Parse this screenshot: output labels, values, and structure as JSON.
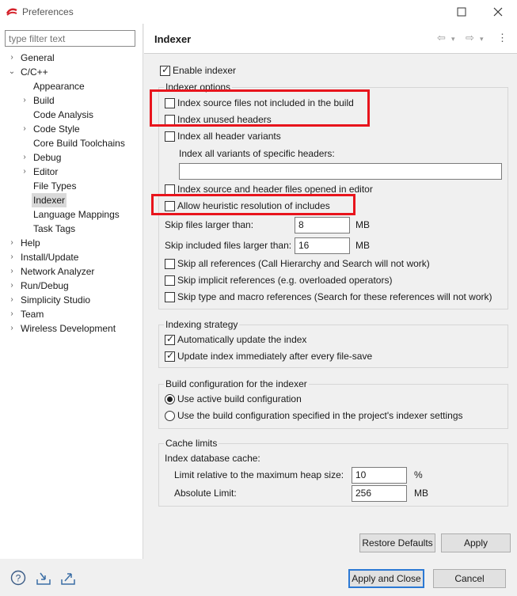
{
  "window": {
    "title": "Preferences"
  },
  "sidebar": {
    "filter_placeholder": "type filter text",
    "items": [
      {
        "label": "General",
        "twisty": "›"
      },
      {
        "label": "C/C++",
        "twisty": "⌄"
      },
      {
        "label": "Appearance",
        "twisty": ""
      },
      {
        "label": "Build",
        "twisty": "›"
      },
      {
        "label": "Code Analysis",
        "twisty": ""
      },
      {
        "label": "Code Style",
        "twisty": "›"
      },
      {
        "label": "Core Build Toolchains",
        "twisty": ""
      },
      {
        "label": "Debug",
        "twisty": "›"
      },
      {
        "label": "Editor",
        "twisty": "›"
      },
      {
        "label": "File Types",
        "twisty": ""
      },
      {
        "label": "Indexer",
        "twisty": ""
      },
      {
        "label": "Language Mappings",
        "twisty": ""
      },
      {
        "label": "Task Tags",
        "twisty": ""
      },
      {
        "label": "Help",
        "twisty": "›"
      },
      {
        "label": "Install/Update",
        "twisty": "›"
      },
      {
        "label": "Network Analyzer",
        "twisty": "›"
      },
      {
        "label": "Run/Debug",
        "twisty": "›"
      },
      {
        "label": "Simplicity Studio",
        "twisty": "›"
      },
      {
        "label": "Team",
        "twisty": "›"
      },
      {
        "label": "Wireless Development",
        "twisty": "›"
      }
    ]
  },
  "page": {
    "title": "Indexer",
    "enable_indexer": {
      "label": "Enable indexer",
      "checked": true
    },
    "indexer_options": {
      "title": "Indexer options",
      "index_source_not_in_build": {
        "label": "Index source files not included in the build",
        "checked": false
      },
      "index_unused_headers": {
        "label": "Index unused headers",
        "checked": false
      },
      "index_all_header_variants": {
        "label": "Index all header variants",
        "checked": false
      },
      "variants_specific_label": "Index all variants of specific headers:",
      "variants_specific_value": "",
      "index_opened_in_editor": {
        "label": "Index source and header files opened in editor",
        "checked": false
      },
      "heuristic_resolution": {
        "label": "Allow heuristic resolution of includes",
        "checked": false
      },
      "skip_files_label": "Skip files larger than:",
      "skip_files_value": "8",
      "skip_files_unit": "MB",
      "skip_included_label": "Skip included files larger than:",
      "skip_included_value": "16",
      "skip_included_unit": "MB",
      "skip_all_refs": {
        "label": "Skip all references (Call Hierarchy and Search will not work)",
        "checked": false
      },
      "skip_implicit_refs": {
        "label": "Skip implicit references (e.g. overloaded operators)",
        "checked": false
      },
      "skip_type_macro_refs": {
        "label": "Skip type and macro references (Search for these references will not work)",
        "checked": false
      }
    },
    "indexing_strategy": {
      "title": "Indexing strategy",
      "auto_update": {
        "label": "Automatically update the index",
        "checked": true
      },
      "update_on_save": {
        "label": "Update index immediately after every file-save",
        "checked": true
      }
    },
    "build_config": {
      "title": "Build configuration for the indexer",
      "use_active": {
        "label": "Use active build configuration",
        "selected": true
      },
      "use_specified": {
        "label": "Use the build configuration specified in the project's indexer settings",
        "selected": false
      }
    },
    "cache_limits": {
      "title": "Cache limits",
      "db_cache_label": "Index database cache:",
      "relative_label": "Limit relative to the maximum heap size:",
      "relative_value": "10",
      "relative_unit": "%",
      "absolute_label": "Absolute Limit:",
      "absolute_value": "256",
      "absolute_unit": "MB"
    },
    "restore_defaults": "Restore Defaults",
    "apply": "Apply"
  },
  "footer": {
    "apply_and_close": "Apply and Close",
    "cancel": "Cancel"
  },
  "colors": {
    "highlight": "#e8141c",
    "default_button_border": "#2b79d4"
  }
}
